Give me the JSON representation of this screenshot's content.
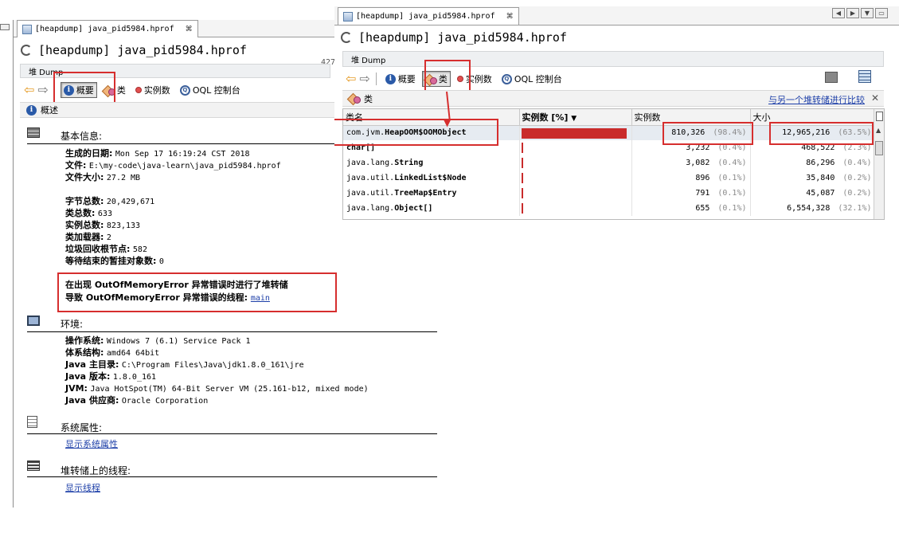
{
  "left": {
    "tab": {
      "title": "[heapdump] java_pid5984.hprof",
      "close": "⌘"
    },
    "title": "[heapdump] java_pid5984.hprof",
    "dump_label": "堆 Dump",
    "toolbar": {
      "summary": "概要",
      "classes": "类",
      "instances": "实例数",
      "oql": "OQL 控制台"
    },
    "section_bar": "概述",
    "clipped_text": "427",
    "basic": {
      "heading": "基本信息:",
      "date_k": "生成的日期:",
      "date_v": "Mon Sep 17 16:19:24 CST 2018",
      "file_k": "文件:",
      "file_v": "E:\\my-code\\java-learn\\java_pid5984.hprof",
      "size_k": "文件大小:",
      "size_v": "27.2 MB",
      "bytes_k": "字节总数:",
      "bytes_v": "20,429,671",
      "classes_k": "类总数:",
      "classes_v": "633",
      "instances_k": "实例总数:",
      "instances_v": "823,133",
      "loaders_k": "类加载器:",
      "loaders_v": "2",
      "gcroots_k": "垃圾回收根节点:",
      "gcroots_v": "582",
      "pending_k": "等待结束的暂挂对象数:",
      "pending_v": "0",
      "oom_line1": "在出现 OutOfMemoryError 异常错误时进行了堆转储",
      "oom_line2_prefix": "导致 OutOfMemoryError 异常错误的线程:",
      "oom_thread": "main"
    },
    "env": {
      "heading": "环境:",
      "os_k": "操作系统:",
      "os_v": "Windows 7 (6.1) Service Pack 1",
      "arch_k": "体系结构:",
      "arch_v": "amd64 64bit",
      "home_k": "Java 主目录:",
      "home_v": "C:\\Program Files\\Java\\jdk1.8.0_161\\jre",
      "ver_k": "Java 版本:",
      "ver_v": "1.8.0_161",
      "jvm_k": "JVM:",
      "jvm_v": "Java HotSpot(TM) 64-Bit Server VM (25.161-b12, mixed mode)",
      "vendor_k": "Java 供应商:",
      "vendor_v": "Oracle Corporation"
    },
    "sysprops": {
      "heading": "系统属性:",
      "link": "显示系统属性"
    },
    "threads": {
      "heading": "堆转储上的线程:",
      "link": "显示线程"
    }
  },
  "right": {
    "tab": {
      "title": "[heapdump] java_pid5984.hprof",
      "close": "⌘"
    },
    "title": "[heapdump] java_pid5984.hprof",
    "dump_label": "堆 Dump",
    "toolbar": {
      "summary": "概要",
      "classes": "类",
      "instances": "实例数",
      "oql": "OQL 控制台"
    },
    "section_bar": "类",
    "compare_link": "与另一个堆转储进行比较",
    "columns": {
      "name": "类名",
      "bar": "实例数 [%]",
      "count": "实例数",
      "size": "大小"
    },
    "sort_indicator": "▼",
    "rows": [
      {
        "pre": "com.jvm.",
        "bold": "HeapOOM$OOMObject",
        "count": "810,326",
        "count_pct": "(98.4%)",
        "size": "12,965,216",
        "size_pct": "(63.5%)",
        "bar": 0.984
      },
      {
        "pre": "",
        "bold": "char[]",
        "count": "3,232",
        "count_pct": "(0.4%)",
        "size": "468,522",
        "size_pct": "(2.3%)",
        "bar": 0.004
      },
      {
        "pre": "java.lang.",
        "bold": "String",
        "count": "3,082",
        "count_pct": "(0.4%)",
        "size": "86,296",
        "size_pct": "(0.4%)",
        "bar": 0.004
      },
      {
        "pre": "java.util.",
        "bold": "LinkedList$Node",
        "count": "896",
        "count_pct": "(0.1%)",
        "size": "35,840",
        "size_pct": "(0.2%)",
        "bar": 0.001
      },
      {
        "pre": "java.util.",
        "bold": "TreeMap$Entry",
        "count": "791",
        "count_pct": "(0.1%)",
        "size": "45,087",
        "size_pct": "(0.2%)",
        "bar": 0.001
      },
      {
        "pre": "java.lang.",
        "bold": "Object[]",
        "count": "655",
        "count_pct": "(0.1%)",
        "size": "6,554,328",
        "size_pct": "(32.1%)",
        "bar": 0.001
      }
    ]
  },
  "colors": {
    "highlight": "#d62e2e",
    "bar": "#c92b2b",
    "link": "#1d3fa8"
  }
}
